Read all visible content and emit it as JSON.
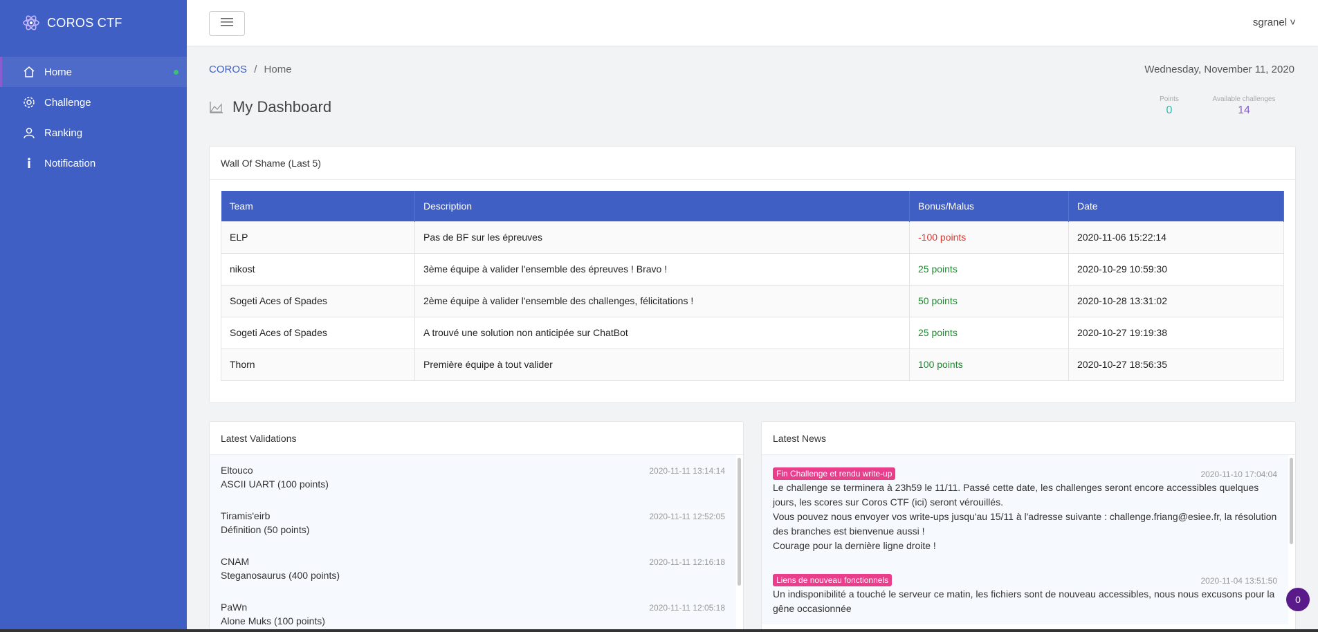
{
  "brand": {
    "name": "COROS CTF"
  },
  "sidebar": {
    "items": [
      {
        "label": "Home"
      },
      {
        "label": "Challenge"
      },
      {
        "label": "Ranking"
      },
      {
        "label": "Notification"
      }
    ]
  },
  "topbar": {
    "user": "sgranel ˅"
  },
  "breadcrumb": {
    "root": "COROS",
    "sep": "/",
    "current": "Home"
  },
  "date": "Wednesday, November 11, 2020",
  "dashboard": {
    "title": "My Dashboard"
  },
  "stats": {
    "points_label": "Points",
    "points_value": "0",
    "challenges_label": "Available challenges",
    "challenges_value": "14",
    "points_color": "#2bbbad",
    "challenges_color": "#8a5cd0"
  },
  "wall": {
    "title": "Wall Of Shame (Last 5)",
    "headers": [
      "Team",
      "Description",
      "Bonus/Malus",
      "Date"
    ],
    "rows": [
      {
        "team": "ELP",
        "desc": "Pas de BF sur les épreuves",
        "bonus": "-100 points",
        "date": "2020-11-06 15:22:14"
      },
      {
        "team": "nikost",
        "desc": "3ème équipe à valider l'ensemble des épreuves ! Bravo !",
        "bonus": "25 points",
        "date": "2020-10-29 10:59:30"
      },
      {
        "team": "Sogeti Aces of Spades",
        "desc": "2ème équipe à valider l'ensemble des challenges, félicitations !",
        "bonus": "50 points",
        "date": "2020-10-28 13:31:02"
      },
      {
        "team": "Sogeti Aces of Spades",
        "desc": "A trouvé une solution non anticipée sur ChatBot",
        "bonus": "25 points",
        "date": "2020-10-27 19:19:38"
      },
      {
        "team": "Thorn",
        "desc": "Première équipe à tout valider",
        "bonus": "100 points",
        "date": "2020-10-27 18:56:35"
      }
    ],
    "negative_color": "#e3342f",
    "positive_color": "#1d8a2e"
  },
  "validations": {
    "title": "Latest Validations",
    "items": [
      {
        "team": "Eltouco",
        "challenge": "ASCII UART (100 points)",
        "ts": "2020-11-11 13:14:14"
      },
      {
        "team": "Tiramis'eirb",
        "challenge": "Définition (50 points)",
        "ts": "2020-11-11 12:52:05"
      },
      {
        "team": "CNAM",
        "challenge": "Steganosaurus (400 points)",
        "ts": "2020-11-11 12:16:18"
      },
      {
        "team": "PaWn",
        "challenge": "Alone Muks (100 points)",
        "ts": "2020-11-11 12:05:18"
      }
    ]
  },
  "news": {
    "title": "Latest News",
    "items": [
      {
        "badge": "Fin Challenge et rendu write-up",
        "ts": "2020-11-10 17:04:04",
        "lines": [
          "Le challenge se terminera à 23h59 le 11/11. Passé cette date, les challenges seront encore accessibles quelques jours, les scores sur Coros CTF (ici) seront vérouillés.",
          "Vous pouvez nous envoyer vos write-ups jusqu'au 15/11 à l'adresse suivante : challenge.friang@esiee.fr, la résolution des branches est bienvenue aussi !",
          "Courage pour la dernière ligne droite !"
        ]
      },
      {
        "badge": "Liens de nouveau fonctionnels",
        "ts": "2020-11-04 13:51:50",
        "lines": [
          "Un indisponibilité a touché le serveur ce matin, les fichiers sont de nouveau accessibles, nous nous excusons pour la gêne occasionnée"
        ]
      }
    ]
  },
  "fab": {
    "count": "0"
  }
}
